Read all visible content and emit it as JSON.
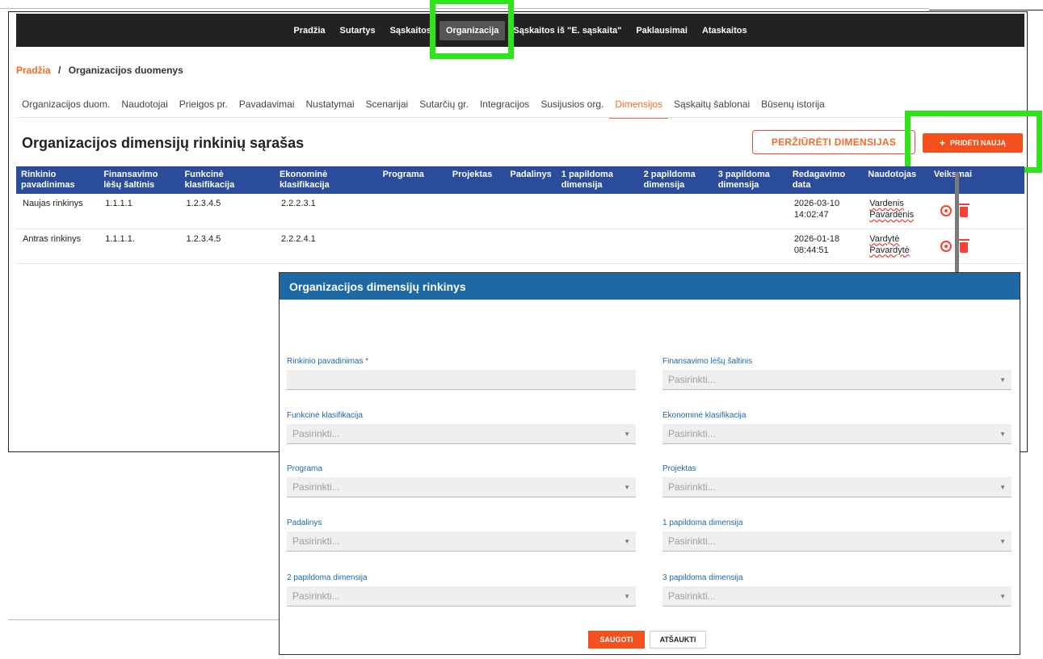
{
  "nav": {
    "items": [
      {
        "label": "Pradžia",
        "active": false
      },
      {
        "label": "Sutartys",
        "active": false
      },
      {
        "label": "Sąskaitos",
        "active": false
      },
      {
        "label": "Organizacija",
        "active": true
      },
      {
        "label": "Sąskaitos iš \"E. sąskaita\"",
        "active": false
      },
      {
        "label": "Paklausimai",
        "active": false
      },
      {
        "label": "Ataskaitos",
        "active": false
      }
    ]
  },
  "breadcrumb": {
    "home": "Pradžia",
    "separator": "/",
    "current": "Organizacijos duomenys"
  },
  "tabs": [
    {
      "label": "Organizacijos duom.",
      "active": false
    },
    {
      "label": "Naudotojai",
      "active": false
    },
    {
      "label": "Prieigos pr.",
      "active": false
    },
    {
      "label": "Pavadavimai",
      "active": false
    },
    {
      "label": "Nustatymai",
      "active": false
    },
    {
      "label": "Scenarijai",
      "active": false
    },
    {
      "label": "Sutarčių gr.",
      "active": false
    },
    {
      "label": "Integracijos",
      "active": false
    },
    {
      "label": "Susijusios org.",
      "active": false
    },
    {
      "label": "Dimensijos",
      "active": true
    },
    {
      "label": "Sąskaitų šablonai",
      "active": false
    },
    {
      "label": "Būsenų istorija",
      "active": false
    }
  ],
  "page": {
    "title": "Organizacijos dimensijų rinkinių sąrašas",
    "view_button": "PERŽIŪRĖTI DIMENSIJAS",
    "add_button": "PRIDĖTI NAUJĄ",
    "add_button_icon": "+"
  },
  "table": {
    "headers": [
      "Rinkinio pavadinimas",
      "Finansavimo lėšų šaltinis",
      "Funkcinė klasifikacija",
      "Ekonominė klasifikacija",
      "Programa",
      "Projektas",
      "Padalinys",
      "1 papildoma dimensija",
      "2 papildoma dimensija",
      "3 papildoma dimensija",
      "Redagavimo data",
      "Naudotojas",
      "Veiksmai"
    ],
    "rows": [
      {
        "name": "Naujas rinkinys",
        "source": "1.1.1.1",
        "func": "1.2.3.4.5",
        "econ": "2.2.2.3.1",
        "program": "",
        "project": "",
        "unit": "",
        "d1": "",
        "d2": "",
        "d3": "",
        "date": "2026-03-10",
        "time": "14:02:47",
        "user": "Vardenis Pavardenis"
      },
      {
        "name": "Antras rinkinys",
        "source": "1.1.1.1.",
        "func": "1.2.3.4.5",
        "econ": "2.2.2.4.1",
        "program": "",
        "project": "",
        "unit": "",
        "d1": "",
        "d2": "",
        "d3": "",
        "date": "2026-01-18",
        "time": "08:44:51",
        "user": "Vardytė Pavardytė"
      }
    ]
  },
  "modal": {
    "title": "Organizacijos dimensijų rinkinys",
    "placeholder": "Pasirinkti...",
    "fields": [
      {
        "label": "Rinkinio pavadinimas *",
        "type": "text"
      },
      {
        "label": "Finansavimo lėšų šaltinis",
        "type": "select"
      },
      {
        "label": "Funkcinė klasifikacija",
        "type": "select"
      },
      {
        "label": "Ekonominė klasifikacija",
        "type": "select"
      },
      {
        "label": "Programa",
        "type": "select"
      },
      {
        "label": "Projektas",
        "type": "select"
      },
      {
        "label": "Padalinys",
        "type": "select"
      },
      {
        "label": "1 papildoma dimensija",
        "type": "select"
      },
      {
        "label": "2 papildoma dimensija",
        "type": "select"
      },
      {
        "label": "3 papildoma dimensija",
        "type": "select"
      }
    ],
    "save_label": "SAUGOTI",
    "cancel_label": "ATŠAUKTI"
  },
  "icons": {
    "view": "eye-icon",
    "delete": "trash-icon",
    "dropdown": "caret-down-icon"
  },
  "colors": {
    "accent": "#f4511e",
    "table_header": "#2b4c9a",
    "modal_header": "#1f68a6",
    "highlight": "#2ee41a",
    "navbar": "#222222"
  }
}
